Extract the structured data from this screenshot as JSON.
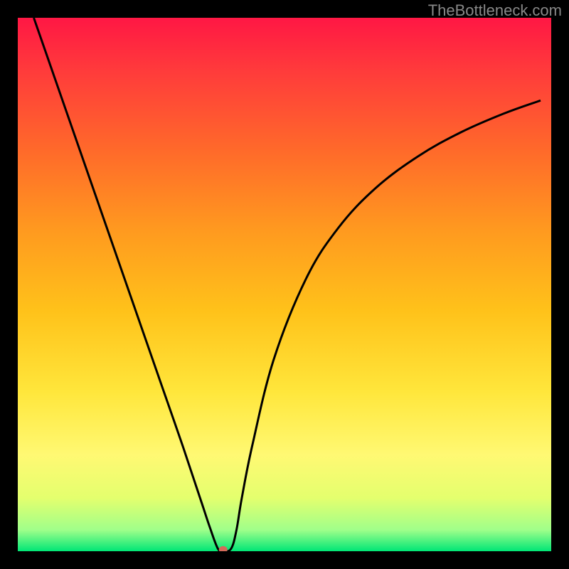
{
  "watermark": "TheBottleneck.com",
  "chart_data": {
    "type": "line",
    "title": "",
    "xlabel": "",
    "ylabel": "",
    "xlim": [
      0,
      100
    ],
    "ylim": [
      0,
      100
    ],
    "grid": false,
    "background_gradient": {
      "stops": [
        {
          "pos": 0.0,
          "color": "#ff1744"
        },
        {
          "pos": 0.1,
          "color": "#ff3b3b"
        },
        {
          "pos": 0.25,
          "color": "#ff6a2a"
        },
        {
          "pos": 0.4,
          "color": "#ff9a1f"
        },
        {
          "pos": 0.55,
          "color": "#ffc21a"
        },
        {
          "pos": 0.7,
          "color": "#ffe63b"
        },
        {
          "pos": 0.82,
          "color": "#fff973"
        },
        {
          "pos": 0.9,
          "color": "#e4ff6e"
        },
        {
          "pos": 0.96,
          "color": "#a0ff8a"
        },
        {
          "pos": 1.0,
          "color": "#00e676"
        }
      ]
    },
    "series": [
      {
        "name": "bottleneck-curve",
        "color": "#000000",
        "x": [
          3,
          7,
          11,
          15,
          19,
          23,
          27,
          31,
          34.5,
          36,
          37.5,
          38.5,
          40,
          41,
          42,
          44,
          48,
          54,
          60,
          67,
          75,
          83,
          91,
          98
        ],
        "y": [
          100,
          88.5,
          77,
          65.5,
          54,
          42.5,
          31,
          19.5,
          9,
          4.5,
          0.5,
          0,
          0.5,
          4,
          10,
          20,
          36,
          51,
          60.5,
          68,
          74,
          78.5,
          82,
          84.5
        ]
      }
    ],
    "markers": [
      {
        "name": "optimal-point",
        "x": 38.5,
        "y": 0.3,
        "color": "#d46a5a",
        "rx": 6,
        "ry": 5
      }
    ]
  }
}
